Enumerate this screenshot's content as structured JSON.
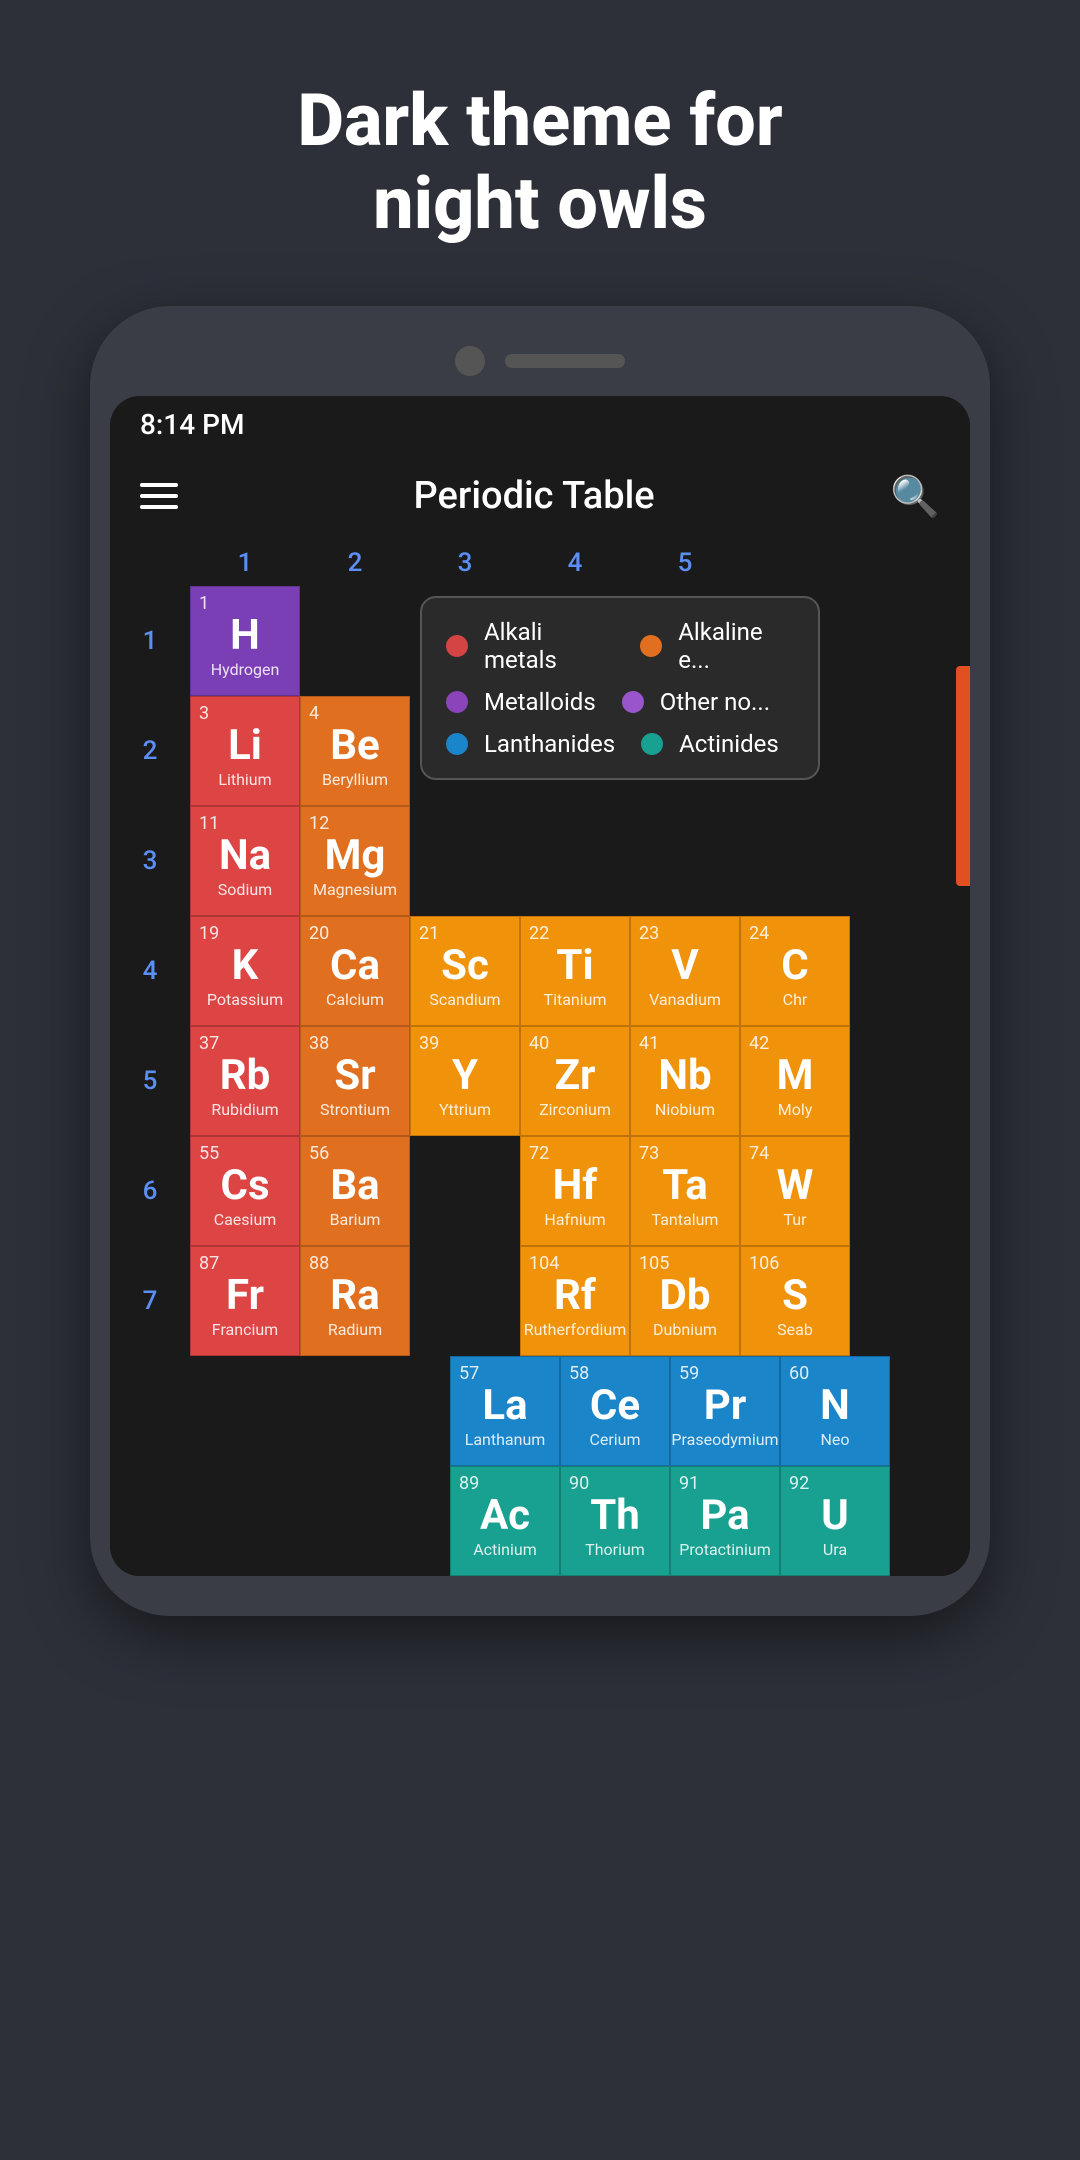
{
  "hero": {
    "title": "Dark theme for\nnight owls"
  },
  "status_bar": {
    "time": "8:14 PM"
  },
  "app_bar": {
    "title": "Periodic Table"
  },
  "columns": [
    "1",
    "2",
    "3",
    "4",
    "5"
  ],
  "rows": [
    "1",
    "2",
    "3",
    "4",
    "5",
    "6",
    "7"
  ],
  "elements": {
    "row1": [
      {
        "num": "1",
        "sym": "H",
        "name": "Hydrogen",
        "color": "hydrogen-cell",
        "col": 0
      }
    ],
    "row2": [
      {
        "num": "3",
        "sym": "Li",
        "name": "Lithium",
        "color": "alkali-metal",
        "col": 0
      },
      {
        "num": "4",
        "sym": "Be",
        "name": "Beryllium",
        "color": "alkaline-earth",
        "col": 1
      }
    ],
    "row3": [
      {
        "num": "11",
        "sym": "Na",
        "name": "Sodium",
        "color": "alkali-metal",
        "col": 0
      },
      {
        "num": "12",
        "sym": "Mg",
        "name": "Magnesium",
        "color": "alkaline-earth",
        "col": 1
      }
    ],
    "row4": [
      {
        "num": "19",
        "sym": "K",
        "name": "Potassium",
        "color": "alkali-metal",
        "col": 0
      },
      {
        "num": "20",
        "sym": "Ca",
        "name": "Calcium",
        "color": "alkaline-earth",
        "col": 1
      },
      {
        "num": "21",
        "sym": "Sc",
        "name": "Scandium",
        "color": "transition-metal",
        "col": 2
      },
      {
        "num": "22",
        "sym": "Ti",
        "name": "Titanium",
        "color": "transition-metal",
        "col": 3
      },
      {
        "num": "23",
        "sym": "V",
        "name": "Vanadium",
        "color": "transition-metal",
        "col": 4
      },
      {
        "num": "24",
        "sym": "C",
        "name": "Chr",
        "color": "transition-metal",
        "col": 5
      }
    ],
    "row5": [
      {
        "num": "37",
        "sym": "Rb",
        "name": "Rubidium",
        "color": "alkali-metal",
        "col": 0
      },
      {
        "num": "38",
        "sym": "Sr",
        "name": "Strontium",
        "color": "alkaline-earth",
        "col": 1
      },
      {
        "num": "39",
        "sym": "Y",
        "name": "Yttrium",
        "color": "transition-metal",
        "col": 2
      },
      {
        "num": "40",
        "sym": "Zr",
        "name": "Zirconium",
        "color": "transition-metal",
        "col": 3
      },
      {
        "num": "41",
        "sym": "Nb",
        "name": "Niobium",
        "color": "transition-metal",
        "col": 4
      },
      {
        "num": "42",
        "sym": "M",
        "name": "Moly",
        "color": "transition-metal",
        "col": 5
      }
    ],
    "row6": [
      {
        "num": "55",
        "sym": "Cs",
        "name": "Caesium",
        "color": "alkali-metal",
        "col": 0
      },
      {
        "num": "56",
        "sym": "Ba",
        "name": "Barium",
        "color": "alkaline-earth",
        "col": 1
      },
      {
        "num": "",
        "sym": "",
        "name": "",
        "color": "empty",
        "col": 2
      },
      {
        "num": "72",
        "sym": "Hf",
        "name": "Hafnium",
        "color": "transition-metal",
        "col": 3
      },
      {
        "num": "73",
        "sym": "Ta",
        "name": "Tantalum",
        "color": "transition-metal",
        "col": 4
      },
      {
        "num": "74",
        "sym": "W",
        "name": "Tur",
        "color": "transition-metal",
        "col": 5
      }
    ],
    "row7": [
      {
        "num": "87",
        "sym": "Fr",
        "name": "Francium",
        "color": "alkali-metal",
        "col": 0
      },
      {
        "num": "88",
        "sym": "Ra",
        "name": "Radium",
        "color": "alkaline-earth",
        "col": 1
      },
      {
        "num": "",
        "sym": "",
        "name": "",
        "color": "empty",
        "col": 2
      },
      {
        "num": "104",
        "sym": "Rf",
        "name": "Rutherfordium",
        "color": "transition-metal",
        "col": 3
      },
      {
        "num": "105",
        "sym": "Db",
        "name": "Dubnium",
        "color": "transition-metal",
        "col": 4
      },
      {
        "num": "106",
        "sym": "S",
        "name": "Seab",
        "color": "transition-metal",
        "col": 5
      }
    ]
  },
  "lanthanides": [
    {
      "num": "57",
      "sym": "La",
      "name": "Lanthanum",
      "color": "lanthanide"
    },
    {
      "num": "58",
      "sym": "Ce",
      "name": "Cerium",
      "color": "lanthanide"
    },
    {
      "num": "59",
      "sym": "Pr",
      "name": "Praseodymium",
      "color": "lanthanide"
    },
    {
      "num": "60",
      "sym": "N",
      "name": "Neo",
      "color": "lanthanide"
    }
  ],
  "actinides": [
    {
      "num": "89",
      "sym": "Ac",
      "name": "Actinium",
      "color": "actinide"
    },
    {
      "num": "90",
      "sym": "Th",
      "name": "Thorium",
      "color": "actinide"
    },
    {
      "num": "91",
      "sym": "Pa",
      "name": "Protactinium",
      "color": "actinide"
    },
    {
      "num": "92",
      "sym": "U",
      "name": "Ura",
      "color": "actinide"
    }
  ],
  "legend": {
    "items": [
      {
        "label": "Alkali metals",
        "color": "#d44444",
        "side": "left"
      },
      {
        "label": "Alkaline e...",
        "color": "#e07020",
        "side": "right"
      },
      {
        "label": "Metalloids",
        "color": "#8c44bb",
        "side": "left"
      },
      {
        "label": "Other no...",
        "color": "#9955cc",
        "side": "right"
      },
      {
        "label": "Lanthanides",
        "color": "#1a85c8",
        "side": "left"
      },
      {
        "label": "Actinides",
        "color": "#18a090",
        "side": "right"
      }
    ]
  }
}
